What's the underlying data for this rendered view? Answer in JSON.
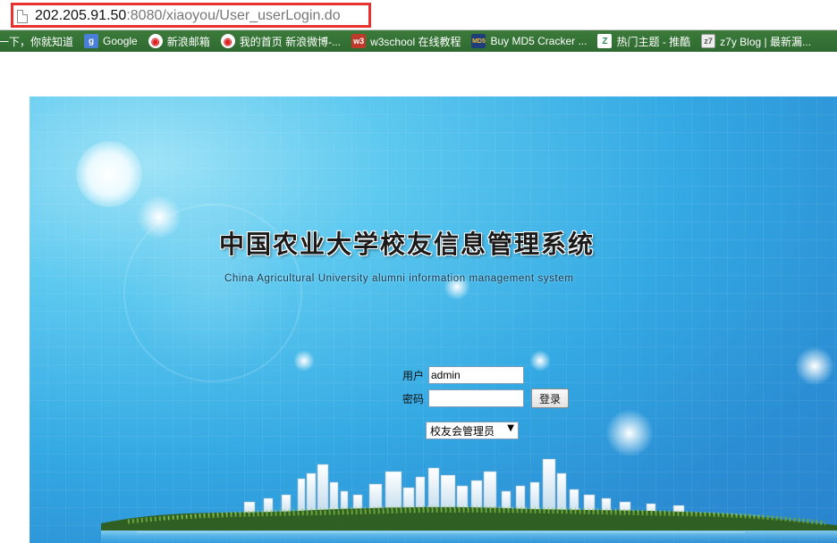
{
  "browser": {
    "url_host": "202.205.91.50",
    "url_path": ":8080/xiaoyou/User_userLogin.do",
    "page_icon": "page-icon"
  },
  "bookmarks": [
    {
      "label": "一下，你就知道",
      "icon": ""
    },
    {
      "label": "Google",
      "icon": "google-icon"
    },
    {
      "label": "新浪邮箱",
      "icon": "weibo-icon"
    },
    {
      "label": "我的首页 新浪微博-...",
      "icon": "weibo-icon"
    },
    {
      "label": "w3school 在线教程",
      "icon": "w3school-icon"
    },
    {
      "label": "Buy MD5 Cracker ...",
      "icon": "md5-icon"
    },
    {
      "label": "热门主题 - 推酷",
      "icon": "tuicool-icon"
    },
    {
      "label": "z7y Blog | 最新漏...",
      "icon": "z7y-icon"
    }
  ],
  "banner": {
    "title_zh": "中国农业大学校友信息管理系统",
    "title_en": "China Agricultural University alumni information management system"
  },
  "form": {
    "username_label": "用户",
    "username_value": "admin",
    "password_label": "密码",
    "password_value": "",
    "login_button": "登录",
    "role_selected": "校友会管理员"
  },
  "colors": {
    "highlight_border": "#e8322f",
    "bookmarks_bar": "#3b7a3b",
    "banner_blue": "#34a9e3"
  }
}
